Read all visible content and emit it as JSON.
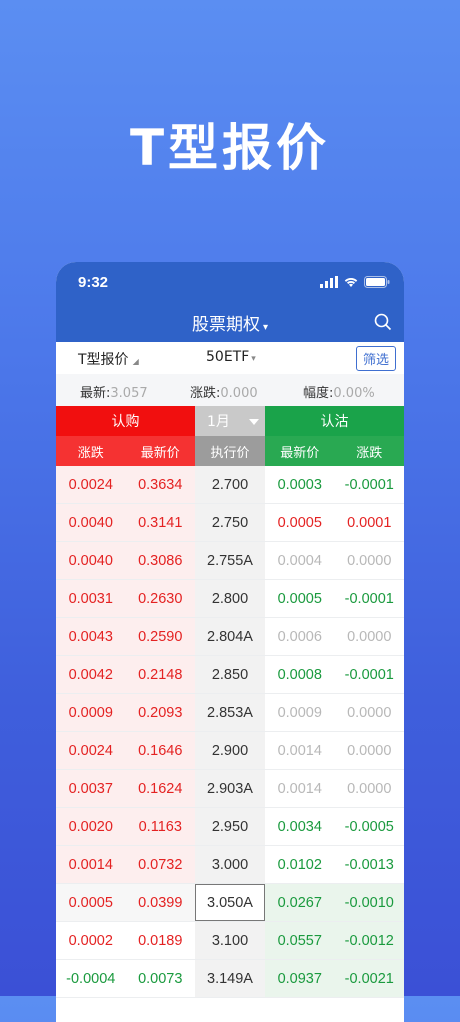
{
  "hero_title": "T型报价",
  "status_bar": {
    "time": "9:32"
  },
  "nav": {
    "title": "股票期权",
    "caret": "▾"
  },
  "toolbar": {
    "type_label": "T型报价",
    "type_caret": "◢",
    "underlying": "50ETF",
    "underlying_caret": "▾",
    "filter_label": "筛选"
  },
  "quote": {
    "latest_label": "最新:",
    "latest_value": "3.057",
    "change_label": "涨跌:",
    "change_value": "0.000",
    "pct_label": "幅度:",
    "pct_value": "0.00%"
  },
  "header": {
    "call": "认购",
    "month": "1月",
    "put": "认沽",
    "cols": {
      "call_change": "涨跌",
      "call_last": "最新价",
      "strike": "执行价",
      "put_last": "最新价",
      "put_change": "涨跌"
    }
  },
  "rows": [
    {
      "cc": "0.0024",
      "cl": "0.3634",
      "k": "2.700",
      "pl": "0.0003",
      "pc": "-0.0001",
      "call_style": "red",
      "pl_style": "green",
      "pc_style": "green"
    },
    {
      "cc": "0.0040",
      "cl": "0.3141",
      "k": "2.750",
      "pl": "0.0005",
      "pc": "0.0001",
      "call_style": "red",
      "pl_style": "red",
      "pc_style": "red"
    },
    {
      "cc": "0.0040",
      "cl": "0.3086",
      "k": "2.755A",
      "pl": "0.0004",
      "pc": "0.0000",
      "call_style": "red",
      "pl_style": "grey",
      "pc_style": "grey"
    },
    {
      "cc": "0.0031",
      "cl": "0.2630",
      "k": "2.800",
      "pl": "0.0005",
      "pc": "-0.0001",
      "call_style": "red",
      "pl_style": "green",
      "pc_style": "green"
    },
    {
      "cc": "0.0043",
      "cl": "0.2590",
      "k": "2.804A",
      "pl": "0.0006",
      "pc": "0.0000",
      "call_style": "red",
      "pl_style": "grey",
      "pc_style": "grey"
    },
    {
      "cc": "0.0042",
      "cl": "0.2148",
      "k": "2.850",
      "pl": "0.0008",
      "pc": "-0.0001",
      "call_style": "red",
      "pl_style": "green",
      "pc_style": "green"
    },
    {
      "cc": "0.0009",
      "cl": "0.2093",
      "k": "2.853A",
      "pl": "0.0009",
      "pc": "0.0000",
      "call_style": "red",
      "pl_style": "grey",
      "pc_style": "grey"
    },
    {
      "cc": "0.0024",
      "cl": "0.1646",
      "k": "2.900",
      "pl": "0.0014",
      "pc": "0.0000",
      "call_style": "red",
      "pl_style": "grey",
      "pc_style": "grey"
    },
    {
      "cc": "0.0037",
      "cl": "0.1624",
      "k": "2.903A",
      "pl": "0.0014",
      "pc": "0.0000",
      "call_style": "red",
      "pl_style": "grey",
      "pc_style": "grey"
    },
    {
      "cc": "0.0020",
      "cl": "0.1163",
      "k": "2.950",
      "pl": "0.0034",
      "pc": "-0.0005",
      "call_style": "red",
      "pl_style": "green",
      "pc_style": "green"
    },
    {
      "cc": "0.0014",
      "cl": "0.0732",
      "k": "3.000",
      "pl": "0.0102",
      "pc": "-0.0013",
      "call_style": "red",
      "pl_style": "green",
      "pc_style": "green"
    },
    {
      "cc": "0.0005",
      "cl": "0.0399",
      "k": "3.050A",
      "pl": "0.0267",
      "pc": "-0.0010",
      "call_style": "red",
      "pl_style": "green",
      "pc_style": "green",
      "atm": true
    },
    {
      "cc": "0.0002",
      "cl": "0.0189",
      "k": "3.100",
      "pl": "0.0557",
      "pc": "-0.0012",
      "call_style": "red",
      "pl_style": "green",
      "pc_style": "green"
    },
    {
      "cc": "-0.0004",
      "cl": "0.0073",
      "k": "3.149A",
      "pl": "0.0937",
      "pc": "-0.0021",
      "call_style": "green",
      "pl_style": "green",
      "pc_style": "green"
    }
  ],
  "colors": {
    "nav_blue": "#2f62c8",
    "call_red": "#f10f0f",
    "put_green": "#1aa34a",
    "up": "#e42222",
    "down": "#1a9a3e"
  }
}
